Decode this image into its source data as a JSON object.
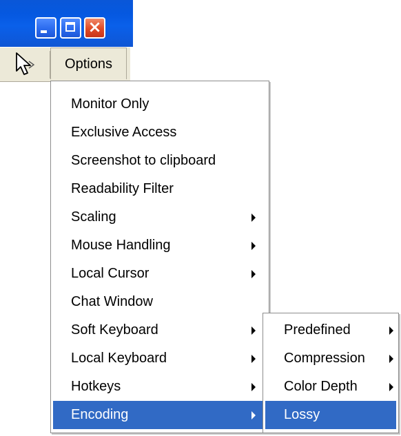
{
  "window": {
    "buttons": {
      "minimize_icon": "minimize-icon",
      "maximize_icon": "maximize-icon",
      "close_icon": "close-icon",
      "close_glyph": "×"
    }
  },
  "menubar": {
    "cursor_icon": "arrow-cursor-icon",
    "options_label": "Options"
  },
  "options_menu": {
    "items": [
      {
        "label": "Monitor Only",
        "submenu": false
      },
      {
        "label": "Exclusive Access",
        "submenu": false
      },
      {
        "label": "Screenshot to clipboard",
        "submenu": false
      },
      {
        "label": "Readability Filter",
        "submenu": false
      },
      {
        "label": "Scaling",
        "submenu": true
      },
      {
        "label": "Mouse Handling",
        "submenu": true
      },
      {
        "label": "Local Cursor",
        "submenu": true
      },
      {
        "label": "Chat Window",
        "submenu": false
      },
      {
        "label": "Soft Keyboard",
        "submenu": true
      },
      {
        "label": "Local Keyboard",
        "submenu": true
      },
      {
        "label": "Hotkeys",
        "submenu": true
      },
      {
        "label": "Encoding",
        "submenu": true,
        "active": true
      }
    ]
  },
  "encoding_submenu": {
    "items": [
      {
        "label": "Predefined",
        "submenu": true
      },
      {
        "label": "Compression",
        "submenu": true
      },
      {
        "label": "Color Depth",
        "submenu": true
      },
      {
        "label": "Lossy",
        "submenu": false,
        "active": true
      }
    ]
  },
  "colors": {
    "titlebar_blue": "#0558e0",
    "menubar_bg": "#ece9d8",
    "highlight": "#316ac5",
    "close_red": "#e04a25"
  }
}
